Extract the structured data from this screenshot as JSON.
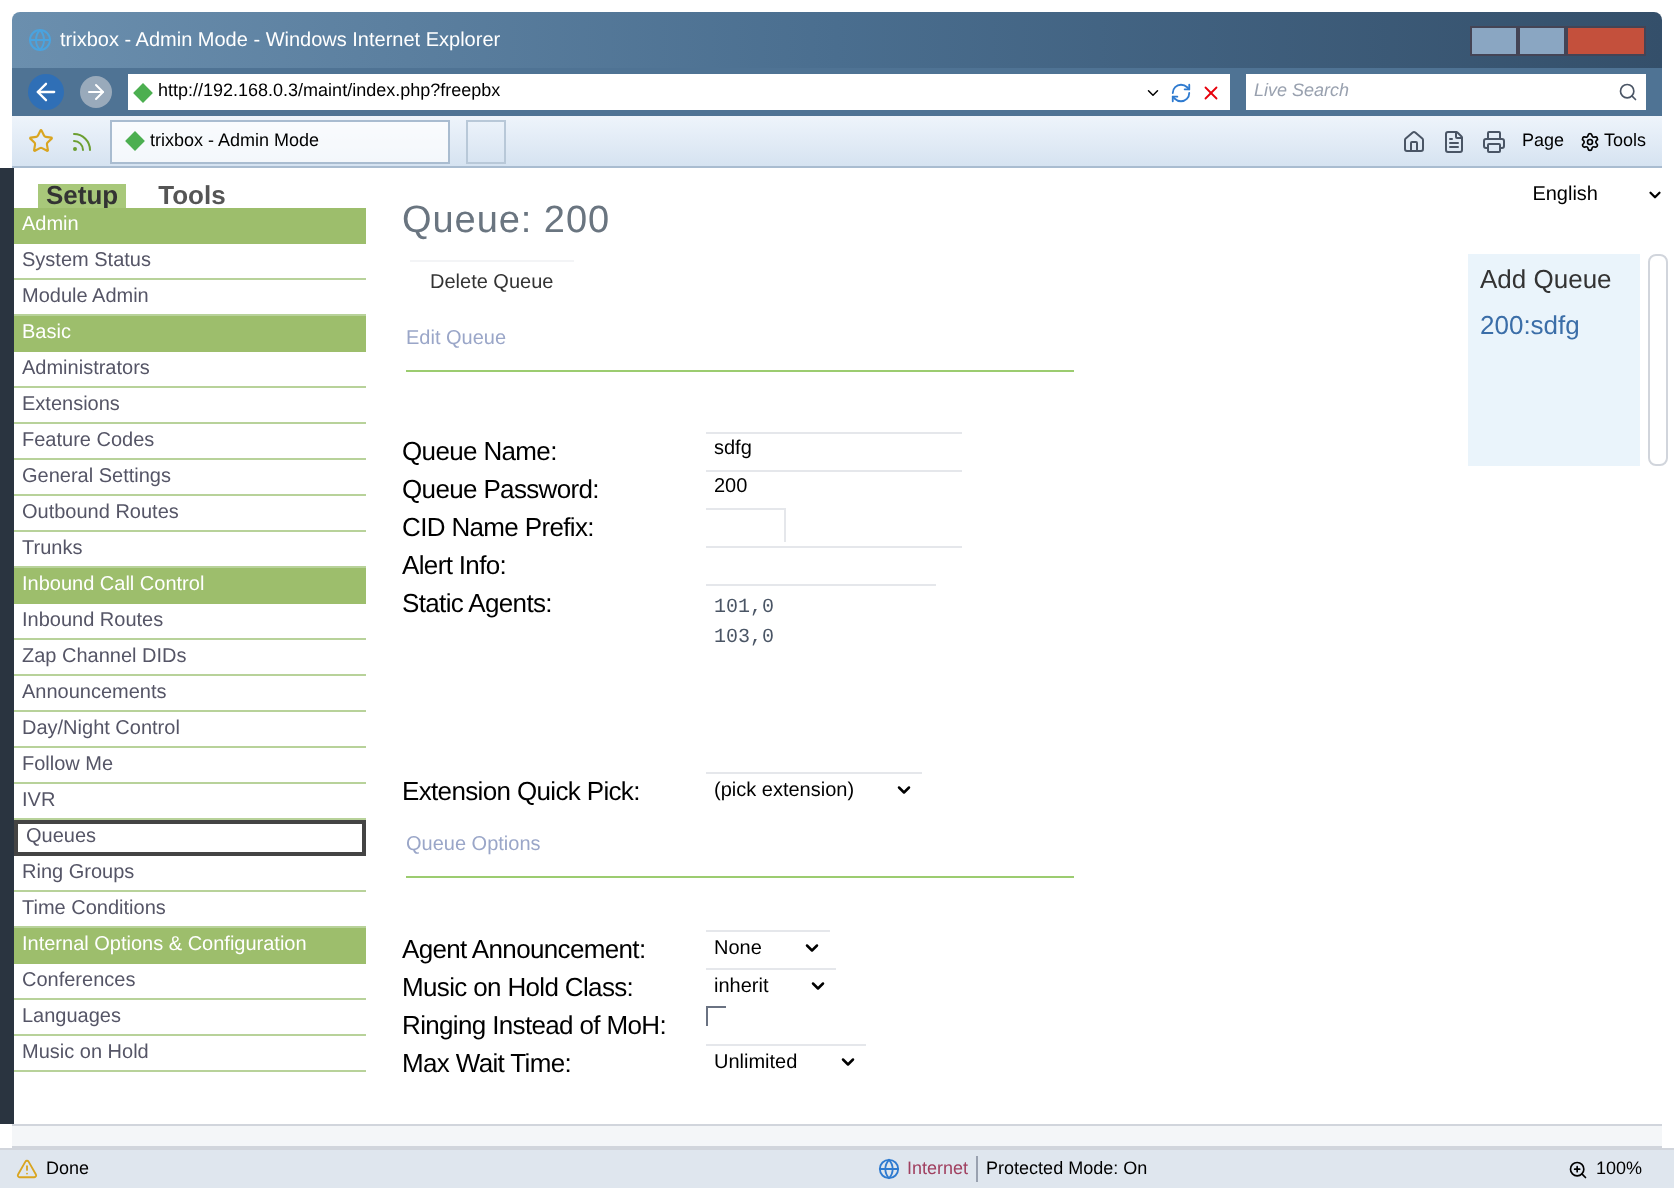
{
  "window": {
    "title": "trixbox - Admin Mode - Windows Internet Explorer"
  },
  "address_bar": {
    "url": "http://192.168.0.3/maint/index.php?freepbx",
    "search_placeholder": "Live Search"
  },
  "tab": {
    "title": "trixbox - Admin Mode"
  },
  "command_bar": [
    "Page",
    "Tools"
  ],
  "sidebar": {
    "tabs": [
      {
        "label": "Setup",
        "selected": true
      },
      {
        "label": "Tools",
        "selected": false
      }
    ],
    "items": [
      {
        "kind": "header",
        "label": "Admin"
      },
      {
        "kind": "link",
        "label": "System Status",
        "selected": false
      },
      {
        "kind": "link",
        "label": "Module Admin",
        "selected": false
      },
      {
        "kind": "header",
        "label": "Basic"
      },
      {
        "kind": "link",
        "label": "Administrators",
        "selected": false
      },
      {
        "kind": "link",
        "label": "Extensions",
        "selected": false
      },
      {
        "kind": "link",
        "label": "Feature Codes",
        "selected": false
      },
      {
        "kind": "link",
        "label": "General Settings",
        "selected": false
      },
      {
        "kind": "link",
        "label": "Outbound Routes",
        "selected": false
      },
      {
        "kind": "link",
        "label": "Trunks",
        "selected": false
      },
      {
        "kind": "header",
        "label": "Inbound Call Control"
      },
      {
        "kind": "link",
        "label": "Inbound Routes",
        "selected": false
      },
      {
        "kind": "link",
        "label": "Zap Channel DIDs",
        "selected": false
      },
      {
        "kind": "link",
        "label": "Announcements",
        "selected": false
      },
      {
        "kind": "link",
        "label": "Day/Night Control",
        "selected": false
      },
      {
        "kind": "link",
        "label": "Follow Me",
        "selected": false
      },
      {
        "kind": "link",
        "label": "IVR",
        "selected": false
      },
      {
        "kind": "link",
        "label": "Queues",
        "selected": true
      },
      {
        "kind": "link",
        "label": "Ring Groups",
        "selected": false
      },
      {
        "kind": "link",
        "label": "Time Conditions",
        "selected": false
      },
      {
        "kind": "header",
        "label": "Internal Options & Configuration"
      },
      {
        "kind": "link",
        "label": "Conferences",
        "selected": false
      },
      {
        "kind": "link",
        "label": "Languages",
        "selected": false
      },
      {
        "kind": "link",
        "label": "Music on Hold",
        "selected": false
      }
    ]
  },
  "main": {
    "title": "Queue: 200",
    "delete_button": "Delete Queue",
    "sections": [
      {
        "heading": "Edit Queue",
        "fields": [
          {
            "kind": "text",
            "label": "Queue Name:",
            "value": "sdfg"
          },
          {
            "kind": "text",
            "label": "Queue Password:",
            "value": "200"
          },
          {
            "kind": "short",
            "label": "CID Name Prefix:"
          },
          {
            "kind": "text",
            "label": "Alert Info:"
          },
          {
            "kind": "textarea",
            "label": "Static Agents:",
            "lines": [
              "101,0",
              "103,0"
            ]
          },
          {
            "kind": "select",
            "label": "Extension Quick Pick:",
            "value": "(pick extension)"
          }
        ]
      },
      {
        "heading": "Queue Options",
        "fields": [
          {
            "kind": "select",
            "label": "Agent Announcement:",
            "value": "None"
          },
          {
            "kind": "select",
            "label": "Music on Hold Class:",
            "value": "inherit"
          },
          {
            "kind": "checkbox",
            "label": "Ringing Instead of MoH:",
            "checked": false
          },
          {
            "kind": "select",
            "label": "Max Wait Time:",
            "value": "Unlimited"
          }
        ]
      }
    ]
  },
  "language": {
    "value": "English"
  },
  "queue_list": {
    "add_label": "Add Queue",
    "items": [
      "200:sdfg"
    ]
  },
  "status_bar": {
    "text": "Done",
    "zone": "Internet",
    "protected_mode": "Protected Mode: On",
    "zoom": "100%"
  }
}
